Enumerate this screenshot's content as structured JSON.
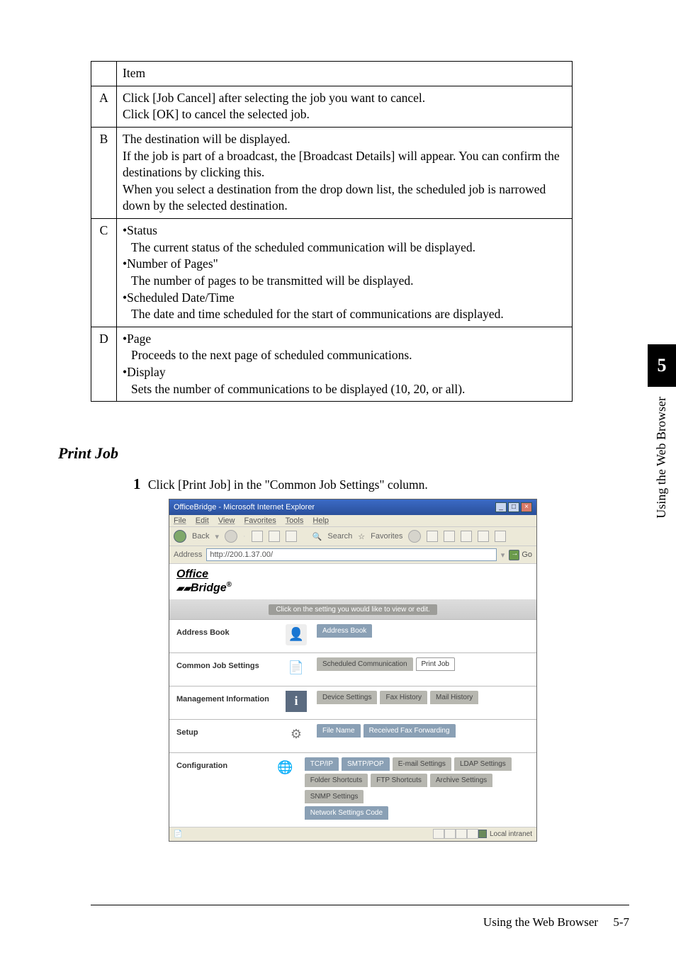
{
  "table": {
    "header": "Item",
    "rows": [
      {
        "letter": "A",
        "lines": [
          "Click [Job Cancel] after selecting the job you want to cancel.",
          "Click [OK] to cancel the selected job."
        ]
      },
      {
        "letter": "B",
        "lines": [
          "The destination will be displayed.",
          "If the job is part of a broadcast, the [Broadcast Details] will appear. You can confirm the destinations by clicking this.",
          "When you select a destination from the drop down list, the scheduled job is narrowed down by the selected destination."
        ]
      },
      {
        "letter": "C",
        "bullets": [
          {
            "title": "•Status",
            "desc": "The current status of the scheduled communication will be displayed."
          },
          {
            "title": "•Number of Pages\"",
            "desc": "The number of pages to be transmitted will be displayed."
          },
          {
            "title": "•Scheduled Date/Time",
            "desc": "The date and time scheduled for the start of communications are displayed."
          }
        ]
      },
      {
        "letter": "D",
        "bullets": [
          {
            "title": "•Page",
            "desc": "Proceeds to the next page of scheduled communications."
          },
          {
            "title": "•Display",
            "desc": "Sets the number of communications to be displayed (10, 20, or all)."
          }
        ]
      }
    ]
  },
  "section_title": "Print Job",
  "step": {
    "num": "1",
    "text": "Click [Print Job] in the \"Common Job Settings\" column."
  },
  "shot": {
    "title": "OfficeBridge - Microsoft Internet Explorer",
    "menus": [
      "File",
      "Edit",
      "View",
      "Favorites",
      "Tools",
      "Help"
    ],
    "toolbar": {
      "back": "Back",
      "search": "Search",
      "favorites": "Favorites"
    },
    "address_label": "Address",
    "address_value": "http://200.1.37.00/",
    "go": "Go",
    "logo1": "Office",
    "logo2": "Bridge",
    "banner": "Click on the setting you would like to view or edit.",
    "sections": {
      "address_book": {
        "label": "Address Book",
        "tabs": [
          "Address Book"
        ]
      },
      "common": {
        "label": "Common Job Settings",
        "tabs": [
          "Scheduled Communication",
          "Print Job"
        ]
      },
      "mgmt": {
        "label": "Management Information",
        "tabs": [
          "Device Settings",
          "Fax History",
          "Mail History"
        ]
      },
      "setup": {
        "label": "Setup",
        "tabs": [
          "File Name",
          "Received Fax Forwarding"
        ]
      },
      "config": {
        "label": "Configuration",
        "row1": [
          "TCP/IP",
          "SMTP/POP",
          "E-mail Settings",
          "LDAP Settings"
        ],
        "row2": [
          "Folder Shortcuts",
          "FTP Shortcuts",
          "Archive Settings",
          "SNMP Settings"
        ],
        "row3": [
          "Network Settings Code"
        ]
      }
    },
    "status_zone": "Local intranet"
  },
  "side": {
    "num": "5",
    "label": "Using the Web Browser"
  },
  "footer": {
    "text": "Using the Web Browser",
    "page": "5-7"
  }
}
